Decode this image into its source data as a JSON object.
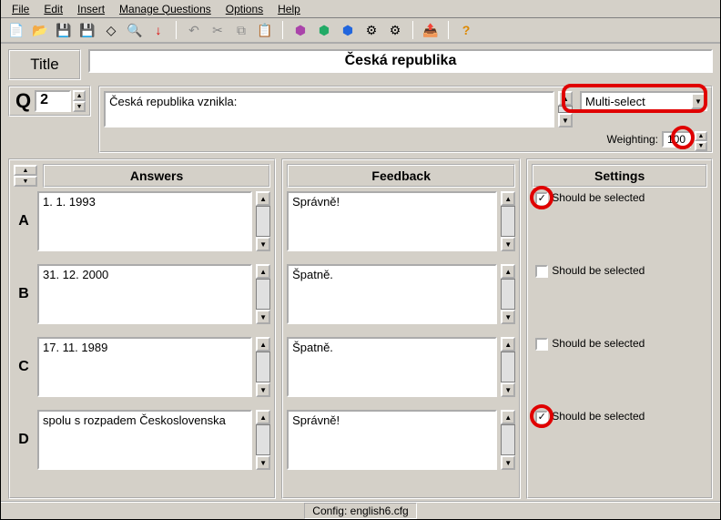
{
  "menu": {
    "file": "File",
    "edit": "Edit",
    "insert": "Insert",
    "manage": "Manage Questions",
    "options": "Options",
    "help": "Help"
  },
  "title_label": "Title",
  "title_value": "Česká republika",
  "question": {
    "letter": "Q",
    "number": "2",
    "text": "Česká republika vznikla:",
    "type": "Multi-select",
    "weighting_label": "Weighting:",
    "weighting": "100"
  },
  "columns": {
    "answers": "Answers",
    "feedback": "Feedback",
    "settings": "Settings"
  },
  "rows": [
    {
      "letter": "A",
      "answer": "1. 1. 1993",
      "feedback": "Správně!",
      "selected": true,
      "label": "Should be selected"
    },
    {
      "letter": "B",
      "answer": "31. 12. 2000",
      "feedback": "Špatně.",
      "selected": false,
      "label": "Should be selected"
    },
    {
      "letter": "C",
      "answer": "17. 11. 1989",
      "feedback": "Špatně.",
      "selected": false,
      "label": "Should be selected"
    },
    {
      "letter": "D",
      "answer": "spolu s rozpadem Československa",
      "feedback": "Správně!",
      "selected": true,
      "label": "Should be selected"
    }
  ],
  "status": "Config: english6.cfg"
}
